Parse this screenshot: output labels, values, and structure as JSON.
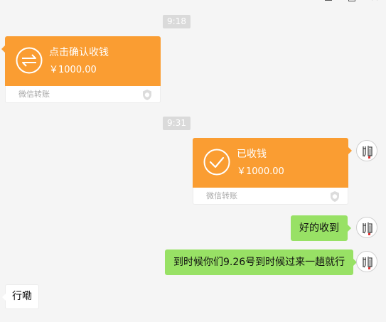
{
  "window": {
    "controls": [
      "minimize-icon",
      "maximize-icon",
      "close-icon"
    ]
  },
  "colors": {
    "background": "#f5f5f5",
    "transfer_card": "#fa9d32",
    "own_bubble": "#98e165",
    "timestamp_bg": "#dadada"
  },
  "messages": {
    "time_1": "9:18",
    "transfer_in": {
      "title": "点击确认收钱",
      "amount": "￥1000.00",
      "source": "微信转账",
      "icon": "transfer-arrows-icon"
    },
    "time_2": "9:31",
    "transfer_received": {
      "title": "已收钱",
      "amount": "￥1000.00",
      "source": "微信转账",
      "icon": "check-circle-icon"
    },
    "reply_1": "好的收到",
    "reply_2": "到时候你们9.26号到时候过来一趟就行",
    "incoming_1": "行嘞"
  }
}
